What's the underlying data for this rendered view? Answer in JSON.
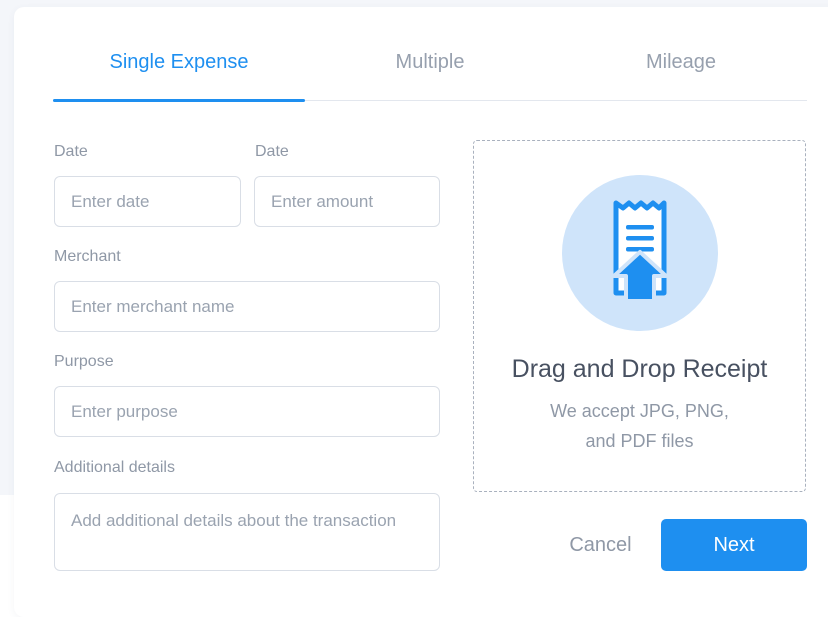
{
  "tabs": {
    "single": "Single Expense",
    "multiple": "Multiple",
    "mileage": "Mileage",
    "active": "Single Expense"
  },
  "form": {
    "date_label": "Date",
    "date_placeholder": "Enter date",
    "amount_label": "Date",
    "amount_placeholder": "Enter amount",
    "merchant_label": "Merchant",
    "merchant_placeholder": "Enter merchant name",
    "purpose_label": "Purpose",
    "purpose_placeholder": "Enter purpose",
    "details_label": "Additional details",
    "details_placeholder": "Add additional details about the transaction"
  },
  "dropzone": {
    "icon": "receipt-upload-icon",
    "title": "Drag and Drop Receipt",
    "subtitle_line1": "We accept JPG, PNG,",
    "subtitle_line2": "and PDF files"
  },
  "actions": {
    "cancel": "Cancel",
    "next": "Next"
  },
  "colors": {
    "accent": "#1e8ff0",
    "icon_circle": "#cfe4fa",
    "muted_text": "#8f98a6",
    "heading_text": "#485161"
  }
}
